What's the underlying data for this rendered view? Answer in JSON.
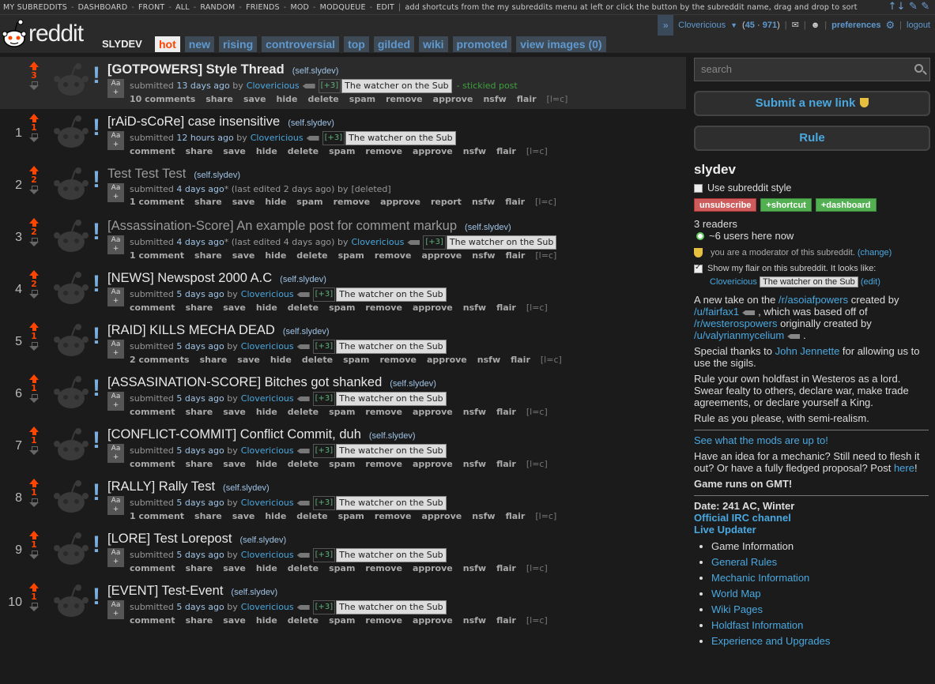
{
  "sr_bar": {
    "items": [
      "MY SUBREDDITS",
      "DASHBOARD",
      "FRONT",
      "ALL",
      "RANDOM",
      "FRIENDS",
      "MOD",
      "MODQUEUE",
      "EDIT"
    ],
    "hint": "add shortcuts from the my subreddits menu at left or click the button by the subreddit name, drag and drop to sort",
    "tools": "↑↓ ✎ ✎"
  },
  "header": {
    "wordmark": "reddit",
    "subreddit": "SLYDEV",
    "tabs": [
      "hot",
      "new",
      "rising",
      "controversial",
      "top",
      "gilded",
      "wiki",
      "promoted",
      "view images (0)"
    ],
    "selected_tab": "hot"
  },
  "user": {
    "name": "Clovericious",
    "karma_link": "45",
    "karma_comment": "971",
    "preferences": "preferences",
    "logout": "logout"
  },
  "posts": [
    {
      "rank": "",
      "score": "3",
      "title": "[GOTPOWERS] Style Thread",
      "domain": "(self.slydev)",
      "age": "13 days ago",
      "edited": "",
      "author": "Clovericious",
      "karma": "[+3]",
      "flair": "The watcher on the Sub",
      "sticky": "- stickied post",
      "comments": "10 comments",
      "buttons": [
        "share",
        "save",
        "hide",
        "delete",
        "spam",
        "remove",
        "approve",
        "nsfw",
        "flair"
      ]
    },
    {
      "rank": "1",
      "score": "1",
      "title": "[rAiD-sCoRe] case insensitive",
      "domain": "(self.slydev)",
      "age": "12 hours ago",
      "edited": "",
      "author": "Clovericious",
      "karma": "[+3]",
      "flair": "The watcher on the Sub",
      "sticky": "",
      "comments": "comment",
      "buttons": [
        "share",
        "save",
        "hide",
        "delete",
        "spam",
        "remove",
        "approve",
        "nsfw",
        "flair"
      ]
    },
    {
      "rank": "2",
      "score": "2",
      "title": "Test Test Test",
      "domain": "(self.slydev)",
      "age": "4 days ago",
      "edited": " * (last edited 2 days ago)",
      "author": "[deleted]",
      "karma": "",
      "flair": "",
      "sticky": "",
      "comments": "1 comment",
      "buttons": [
        "share",
        "save",
        "hide",
        "spam",
        "remove",
        "approve",
        "report",
        "nsfw",
        "flair"
      ]
    },
    {
      "rank": "3",
      "score": "2",
      "title": "[Assassination-Score] An example post for comment markup",
      "domain": "(self.slydev)",
      "age": "4 days ago",
      "edited": " * (last edited 4 days ago)",
      "author": "Clovericious",
      "karma": "[+3]",
      "flair": "The watcher on the Sub",
      "sticky": "",
      "comments": "1 comment",
      "buttons": [
        "share",
        "save",
        "hide",
        "delete",
        "spam",
        "remove",
        "approve",
        "nsfw",
        "flair"
      ]
    },
    {
      "rank": "4",
      "score": "2",
      "title": "[NEWS] Newspost 2000 A.C",
      "domain": "(self.slydev)",
      "age": "5 days ago",
      "edited": "",
      "author": "Clovericious",
      "karma": "[+3]",
      "flair": "The watcher on the Sub",
      "sticky": "",
      "comments": "comment",
      "buttons": [
        "share",
        "save",
        "hide",
        "delete",
        "spam",
        "remove",
        "approve",
        "nsfw",
        "flair"
      ]
    },
    {
      "rank": "5",
      "score": "1",
      "title": "[RAID] KILLS MECHA DEAD",
      "domain": "(self.slydev)",
      "age": "5 days ago",
      "edited": "",
      "author": "Clovericious",
      "karma": "[+3]",
      "flair": "The watcher on the Sub",
      "sticky": "",
      "comments": "2 comments",
      "buttons": [
        "share",
        "save",
        "hide",
        "delete",
        "spam",
        "remove",
        "approve",
        "nsfw",
        "flair"
      ]
    },
    {
      "rank": "6",
      "score": "1",
      "title": "[ASSASINATION-SCORE] Bitches got shanked",
      "domain": "(self.slydev)",
      "age": "5 days ago",
      "edited": "",
      "author": "Clovericious",
      "karma": "[+3]",
      "flair": "The watcher on the Sub",
      "sticky": "",
      "comments": "comment",
      "buttons": [
        "share",
        "save",
        "hide",
        "delete",
        "spam",
        "remove",
        "approve",
        "nsfw",
        "flair"
      ]
    },
    {
      "rank": "7",
      "score": "1",
      "title": "[CONFLICT-COMMIT] Conflict Commit, duh",
      "domain": "(self.slydev)",
      "age": "5 days ago",
      "edited": "",
      "author": "Clovericious",
      "karma": "[+3]",
      "flair": "The watcher on the Sub",
      "sticky": "",
      "comments": "comment",
      "buttons": [
        "share",
        "save",
        "hide",
        "delete",
        "spam",
        "remove",
        "approve",
        "nsfw",
        "flair"
      ]
    },
    {
      "rank": "8",
      "score": "1",
      "title": "[RALLY] Rally Test",
      "domain": "(self.slydev)",
      "age": "5 days ago",
      "edited": "",
      "author": "Clovericious",
      "karma": "[+3]",
      "flair": "The watcher on the Sub",
      "sticky": "",
      "comments": "1 comment",
      "buttons": [
        "share",
        "save",
        "hide",
        "delete",
        "spam",
        "remove",
        "approve",
        "nsfw",
        "flair"
      ]
    },
    {
      "rank": "9",
      "score": "1",
      "title": "[LORE] Test Lorepost",
      "domain": "(self.slydev)",
      "age": "5 days ago",
      "edited": "",
      "author": "Clovericious",
      "karma": "[+3]",
      "flair": "The watcher on the Sub",
      "sticky": "",
      "comments": "comment",
      "buttons": [
        "share",
        "save",
        "hide",
        "delete",
        "spam",
        "remove",
        "approve",
        "nsfw",
        "flair"
      ]
    },
    {
      "rank": "10",
      "score": "1",
      "title": "[EVENT] Test-Event",
      "domain": "(self.slydev)",
      "age": "5 days ago",
      "edited": "",
      "author": "Clovericious",
      "karma": "[+3]",
      "flair": "The watcher on the Sub",
      "sticky": "",
      "comments": "comment",
      "buttons": [
        "share",
        "save",
        "hide",
        "delete",
        "spam",
        "remove",
        "approve",
        "nsfw",
        "flair"
      ]
    }
  ],
  "labels": {
    "submitted": "submitted",
    "by": "by",
    "lc": "[l=c]",
    "aa": "Aa"
  },
  "sidebar": {
    "search_placeholder": "search",
    "submit_link": "Submit a new link",
    "rule_button": "Rule",
    "title": "slydev",
    "use_style": "Use subreddit style",
    "unsubscribe": "unsubscribe",
    "shortcut": "+shortcut",
    "dashboard": "+dashboard",
    "readers": "3 readers",
    "online": "~6 users here now",
    "mod_note": "you are a moderator of this subreddit.",
    "change": "(change)",
    "show_flair": "Show my flair on this subreddit. It looks like:",
    "flair_user": "Clovericious",
    "flair_text": "The watcher on the Sub",
    "edit": "(edit)",
    "desc1_a": "A new take on the ",
    "desc1_link1": "/r/asoiafpowers",
    "desc1_b": " created by ",
    "desc1_link2": "/u/fairfax1",
    "desc1_c": ", which was based off of ",
    "desc1_link3": "/r/westerospowers",
    "desc1_d": " originally created by ",
    "desc1_link4": "/u/valyrianmycelium",
    "desc1_e": ".",
    "thanks_a": "Special thanks to ",
    "thanks_link": "John Jennette",
    "thanks_b": " for allowing us to use the sigils.",
    "rule_text": "Rule your own holdfast in Westeros as a lord. Swear fealty to others, declare war, make trade agreements, or declare yourself a King.",
    "realism": "Rule as you please, with semi-realism.",
    "mods_link": "See what the mods are up to!",
    "idea_a": "Have an idea for a mechanic? Still need to flesh it out? Or have a fully fledged proposal? Post ",
    "idea_link": "here",
    "idea_b": "!",
    "gmt": "Game runs on GMT!",
    "date": "Date: 241 AC, Winter",
    "irc": "Official IRC channel",
    "live": "Live Updater",
    "links": [
      "Game Information",
      "General Rules",
      "Mechanic Information",
      "World Map",
      "Wiki Pages",
      "Holdfast Information",
      "Experience and Upgrades"
    ]
  }
}
